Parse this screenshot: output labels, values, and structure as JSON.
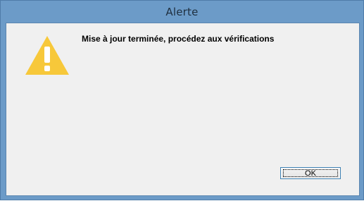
{
  "window": {
    "title": "Alerte"
  },
  "dialog": {
    "message": "Mise à jour terminée, procédez aux vérifications",
    "icon": "warning-icon",
    "ok_label": "OK"
  },
  "colors": {
    "titlebar": "#6c9bc8",
    "client_background": "#f0f0f0",
    "warning_yellow": "#f7c83a"
  }
}
